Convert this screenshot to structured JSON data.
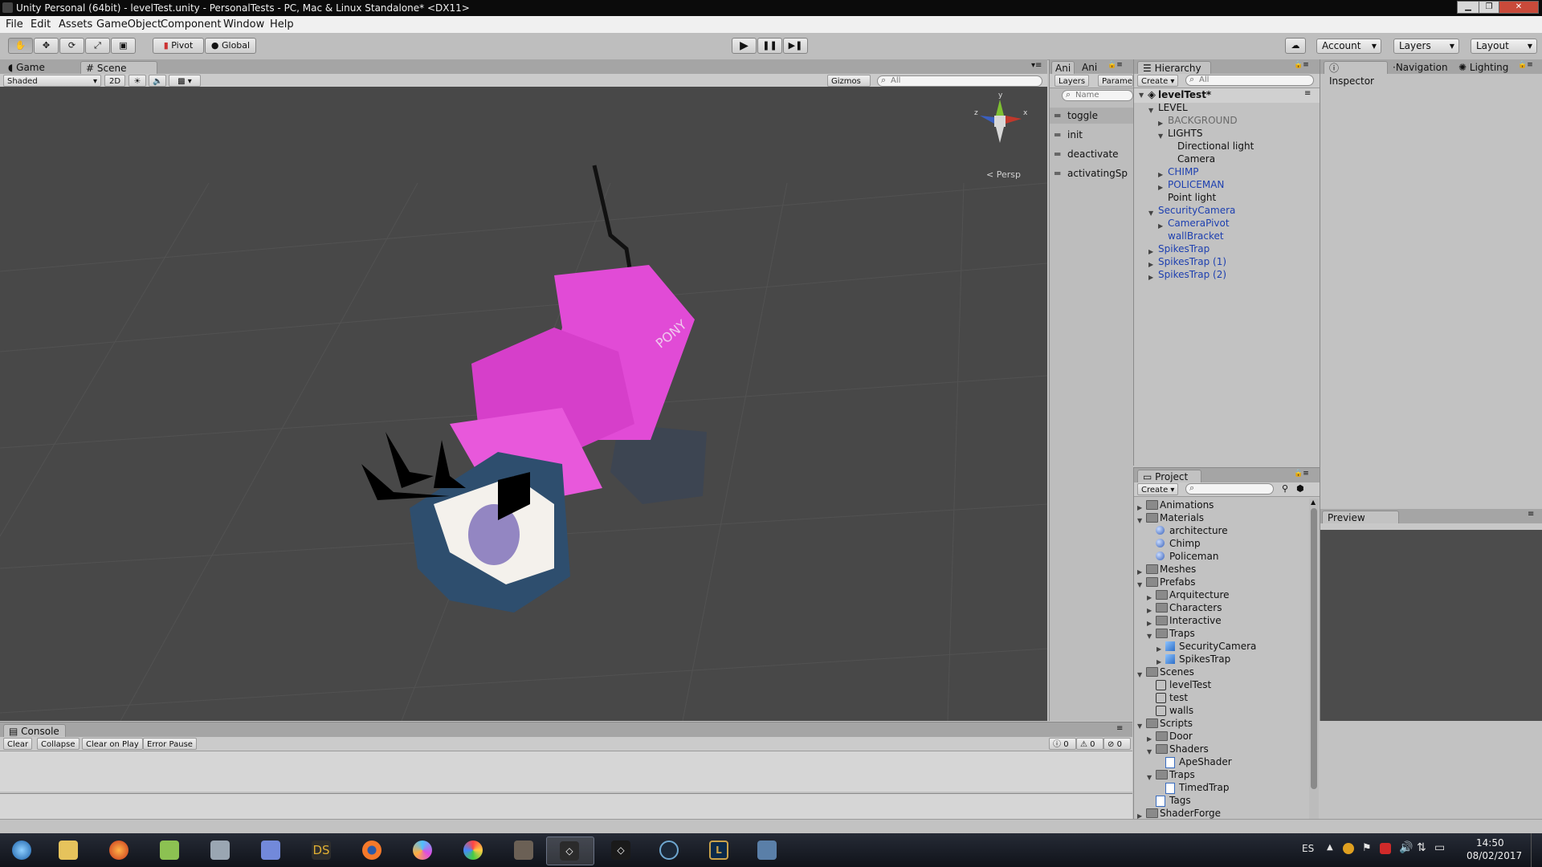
{
  "window": {
    "title": "Unity Personal (64bit) - levelTest.unity - PersonalTests - PC, Mac & Linux Standalone* <DX11>"
  },
  "menu": [
    "File",
    "Edit",
    "Assets",
    "GameObject",
    "Component",
    "Window",
    "Help"
  ],
  "toolbar": {
    "pivot_label": "Pivot",
    "global_label": "Global",
    "account_label": "Account",
    "layers_label": "Layers",
    "layout_label": "Layout"
  },
  "scene_panel": {
    "tabs": [
      "Game",
      "Scene"
    ],
    "shading_mode": "Shaded",
    "mode_2d": "2D",
    "gizmos_label": "Gizmos",
    "search_placeholder": "All",
    "persp_label": "Persp",
    "gizmo_axes": {
      "y": "y",
      "z": "z",
      "x": "x"
    },
    "model_text": "PONY"
  },
  "animator_panel": {
    "tabs": [
      "Ani",
      "Ani"
    ],
    "subtabs": [
      "Layers",
      "Parame"
    ],
    "search_placeholder": "Name",
    "parameters": [
      "toggle",
      "init",
      "deactivate",
      "activatingSp"
    ]
  },
  "hierarchy": {
    "tab_label": "Hierarchy",
    "create_label": "Create",
    "search_placeholder": "All",
    "scene_name": "levelTest*",
    "items": [
      {
        "label": "LEVEL",
        "depth": 1,
        "arrow": "down",
        "color": "normal"
      },
      {
        "label": "BACKGROUND",
        "depth": 2,
        "arrow": "right",
        "color": "gray"
      },
      {
        "label": "LIGHTS",
        "depth": 2,
        "arrow": "down",
        "color": "normal"
      },
      {
        "label": "Directional light",
        "depth": 3,
        "arrow": "none",
        "color": "normal"
      },
      {
        "label": "Camera",
        "depth": 3,
        "arrow": "none",
        "color": "normal"
      },
      {
        "label": "CHIMP",
        "depth": 2,
        "arrow": "right",
        "color": "blue"
      },
      {
        "label": "POLICEMAN",
        "depth": 2,
        "arrow": "right",
        "color": "blue"
      },
      {
        "label": "Point light",
        "depth": 2,
        "arrow": "none",
        "color": "normal"
      },
      {
        "label": "SecurityCamera",
        "depth": 1,
        "arrow": "down",
        "color": "blue"
      },
      {
        "label": "CameraPivot",
        "depth": 2,
        "arrow": "right",
        "color": "blue"
      },
      {
        "label": "wallBracket",
        "depth": 2,
        "arrow": "none",
        "color": "blue"
      },
      {
        "label": "SpikesTrap",
        "depth": 1,
        "arrow": "right",
        "color": "blue"
      },
      {
        "label": "SpikesTrap (1)",
        "depth": 1,
        "arrow": "right",
        "color": "blue"
      },
      {
        "label": "SpikesTrap (2)",
        "depth": 1,
        "arrow": "right",
        "color": "blue"
      }
    ]
  },
  "inspector": {
    "tabs": [
      "Inspector",
      "Navigation",
      "Lighting"
    ],
    "preview_label": "Preview"
  },
  "project": {
    "tab_label": "Project",
    "create_label": "Create",
    "items": [
      {
        "label": "Animations",
        "depth": 0,
        "arrow": "right",
        "icon": "folder"
      },
      {
        "label": "Materials",
        "depth": 0,
        "arrow": "down",
        "icon": "folder"
      },
      {
        "label": "architecture",
        "depth": 1,
        "arrow": "none",
        "icon": "material"
      },
      {
        "label": "Chimp",
        "depth": 1,
        "arrow": "none",
        "icon": "material"
      },
      {
        "label": "Policeman",
        "depth": 1,
        "arrow": "none",
        "icon": "material"
      },
      {
        "label": "Meshes",
        "depth": 0,
        "arrow": "right",
        "icon": "folder"
      },
      {
        "label": "Prefabs",
        "depth": 0,
        "arrow": "down",
        "icon": "folder"
      },
      {
        "label": "Arquitecture",
        "depth": 1,
        "arrow": "right",
        "icon": "folder"
      },
      {
        "label": "Characters",
        "depth": 1,
        "arrow": "right",
        "icon": "folder"
      },
      {
        "label": "Interactive",
        "depth": 1,
        "arrow": "right",
        "icon": "folder"
      },
      {
        "label": "Traps",
        "depth": 1,
        "arrow": "down",
        "icon": "folder"
      },
      {
        "label": "SecurityCamera",
        "depth": 2,
        "arrow": "right",
        "icon": "prefab"
      },
      {
        "label": "SpikesTrap",
        "depth": 2,
        "arrow": "right",
        "icon": "prefab"
      },
      {
        "label": "Scenes",
        "depth": 0,
        "arrow": "down",
        "icon": "folder"
      },
      {
        "label": "levelTest",
        "depth": 1,
        "arrow": "none",
        "icon": "scene"
      },
      {
        "label": "test",
        "depth": 1,
        "arrow": "none",
        "icon": "scene"
      },
      {
        "label": "walls",
        "depth": 1,
        "arrow": "none",
        "icon": "scene"
      },
      {
        "label": "Scripts",
        "depth": 0,
        "arrow": "down",
        "icon": "folder"
      },
      {
        "label": "Door",
        "depth": 1,
        "arrow": "right",
        "icon": "folder"
      },
      {
        "label": "Shaders",
        "depth": 1,
        "arrow": "down",
        "icon": "folder"
      },
      {
        "label": "ApeShader",
        "depth": 2,
        "arrow": "none",
        "icon": "script"
      },
      {
        "label": "Traps",
        "depth": 1,
        "arrow": "down",
        "icon": "folder"
      },
      {
        "label": "TimedTrap",
        "depth": 2,
        "arrow": "none",
        "icon": "script"
      },
      {
        "label": "Tags",
        "depth": 1,
        "arrow": "none",
        "icon": "script"
      },
      {
        "label": "ShaderForge",
        "depth": 0,
        "arrow": "right",
        "icon": "folder"
      }
    ]
  },
  "console": {
    "tab_label": "Console",
    "buttons": [
      "Clear",
      "Collapse",
      "Clear on Play",
      "Error Pause"
    ],
    "counts": {
      "info": "0",
      "warnings": "0",
      "errors": "0"
    }
  },
  "taskbar": {
    "apps": [
      "start",
      "explorer",
      "firefox",
      "notepad",
      "printer",
      "discord",
      "ds",
      "blender",
      "krita",
      "paint",
      "gimp",
      "unity-active",
      "unity",
      "steam",
      "league",
      "app"
    ],
    "lang": "ES",
    "time": "14:50",
    "date": "08/02/2017"
  },
  "colors": {
    "scene_bg": "#484848",
    "model_pink": "#e040d0",
    "unity_panel": "#c2c2c2",
    "link_blue": "#1e40b0"
  }
}
